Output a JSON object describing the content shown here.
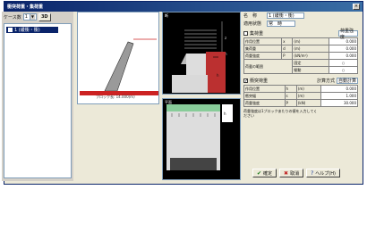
{
  "window": {
    "title": "衝突荷重・集荷重"
  },
  "left": {
    "group_label": "ケース数",
    "group_value": "1",
    "tool_button": "3D",
    "tree_item": "1 (緩衝・衝)"
  },
  "center": {
    "caption": "ブロック長: 14.000(m)"
  },
  "panels": {
    "top_label": "断",
    "bottom_label": "平面"
  },
  "right": {
    "name_label": "名　称",
    "name_value": "1 (緩衝・衝)",
    "load_type_label": "適用状態",
    "load_type_value": "常　時",
    "sec1": {
      "title": "集荷重",
      "header_right": "荷重強度",
      "rows": [
        {
          "label": "作用位置",
          "sym": "x",
          "unit": "(m)",
          "value": "0.000"
        },
        {
          "label": "集荷重",
          "sym": "d",
          "unit": "(m)",
          "value": "0.000"
        },
        {
          "label": "荷重強度",
          "sym": "P",
          "unit": "(kN/m²)",
          "value": "0.000"
        }
      ],
      "range_label": "荷載の範囲",
      "opt1": "固定",
      "opt2": "駆動"
    },
    "sec2": {
      "title": "衝突荷重",
      "subtitle": "計算方式",
      "mode_value": "自動計算",
      "rows": [
        {
          "label": "作用位置",
          "sym": "h",
          "unit": "(m)",
          "value": "0.000"
        },
        {
          "label": "衝突幅",
          "sym": "s",
          "unit": "(m)",
          "value": "1.000"
        },
        {
          "label": "荷重強度",
          "sym": "P",
          "unit": "(kN)",
          "value": "30.000"
        }
      ],
      "note": "荷重強度は1ブロックあたりの値を入力してください"
    }
  },
  "buttons": {
    "ok": "確定",
    "cancel": "取消",
    "help": "ヘルプ(H)"
  }
}
